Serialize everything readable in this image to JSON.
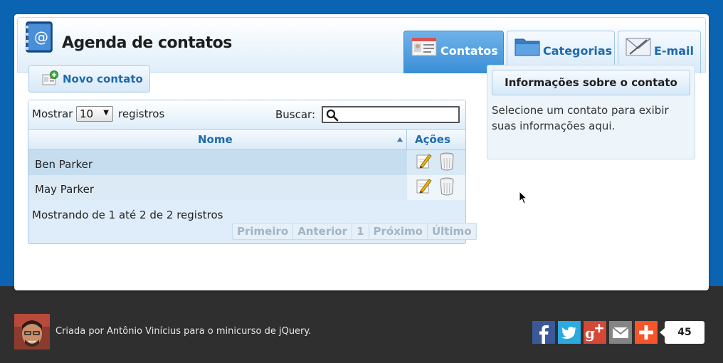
{
  "app": {
    "title": "Agenda de contatos"
  },
  "tabs": [
    {
      "label": "Contatos",
      "active": true
    },
    {
      "label": "Categorias",
      "active": false
    },
    {
      "label": "E-mail",
      "active": false
    }
  ],
  "toolbar": {
    "new_contact_label": "Novo contato"
  },
  "table": {
    "show_label": "Mostrar",
    "page_size": "10",
    "records_label": "registros",
    "search_label": "Buscar:",
    "search_value": "",
    "columns": {
      "name": "Nome",
      "actions": "Ações"
    },
    "rows": [
      {
        "name": "Ben Parker"
      },
      {
        "name": "May Parker"
      }
    ],
    "info": "Mostrando de 1 até 2 de 2 registros",
    "pagination": {
      "first": "Primeiro",
      "prev": "Anterior",
      "page": "1",
      "next": "Próximo",
      "last": "Último"
    }
  },
  "info_panel": {
    "title": "Informações sobre o contato",
    "text": "Selecione um contato para exibir suas informações aqui."
  },
  "footer": {
    "credit": "Criada por Antônio Vinícius para o minicurso de jQuery.",
    "share_count": "45"
  },
  "colors": {
    "accent": "#1f6aad",
    "page_bg": "#0b64b2",
    "footer_bg": "#2f2f2f",
    "facebook": "#3b5998",
    "twitter": "#2ba9e1",
    "google_plus": "#d34836",
    "email": "#848484",
    "addthis": "#f6542b"
  }
}
